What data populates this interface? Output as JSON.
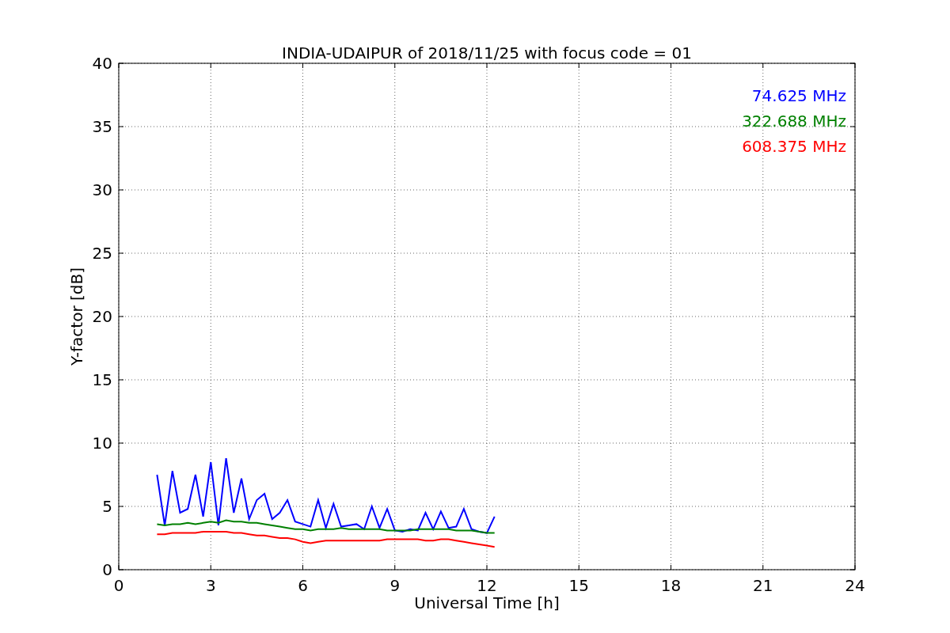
{
  "figure": {
    "chart_data": {
      "type": "line",
      "title": "INDIA-UDAIPUR of 2018/11/25 with focus code = 01",
      "xlabel": "Universal Time [h]",
      "ylabel": "Y-factor [dB]",
      "x": [
        1.25,
        1.5,
        1.75,
        2,
        2.25,
        2.5,
        2.75,
        3,
        3.25,
        3.5,
        3.75,
        4,
        4.25,
        4.5,
        4.75,
        5,
        5.25,
        5.5,
        5.75,
        6,
        6.25,
        6.5,
        6.75,
        7,
        7.25,
        7.5,
        7.75,
        8,
        8.25,
        8.5,
        8.75,
        9,
        9.25,
        9.5,
        9.75,
        10,
        10.25,
        10.5,
        10.75,
        11,
        11.25,
        11.5,
        11.75,
        12,
        12.25
      ],
      "series": [
        {
          "name": "74.625 MHz",
          "color": "#0000ff",
          "values": [
            7.5,
            3.5,
            7.8,
            4.5,
            4.8,
            7.5,
            4.2,
            8.5,
            3.5,
            8.8,
            4.5,
            7.2,
            4.0,
            5.5,
            6.0,
            4.0,
            4.5,
            5.5,
            3.8,
            3.6,
            3.4,
            5.5,
            3.3,
            5.2,
            3.4,
            3.5,
            3.6,
            3.2,
            5.0,
            3.3,
            4.8,
            3.1,
            3.0,
            3.2,
            3.1,
            4.5,
            3.2,
            4.6,
            3.3,
            3.4,
            4.8,
            3.2,
            3.0,
            2.9,
            4.2
          ]
        },
        {
          "name": "322.688 MHz",
          "color": "#008000",
          "values": [
            3.6,
            3.5,
            3.6,
            3.6,
            3.7,
            3.6,
            3.7,
            3.8,
            3.7,
            3.9,
            3.8,
            3.8,
            3.7,
            3.7,
            3.6,
            3.5,
            3.4,
            3.3,
            3.2,
            3.2,
            3.1,
            3.2,
            3.2,
            3.2,
            3.3,
            3.2,
            3.2,
            3.2,
            3.2,
            3.2,
            3.1,
            3.1,
            3.1,
            3.1,
            3.2,
            3.2,
            3.2,
            3.2,
            3.2,
            3.1,
            3.1,
            3.1,
            3.0,
            2.9,
            2.9
          ]
        },
        {
          "name": "608.375 MHz",
          "color": "#ff0000",
          "values": [
            2.8,
            2.8,
            2.9,
            2.9,
            2.9,
            2.9,
            3.0,
            3.0,
            3.0,
            3.0,
            2.9,
            2.9,
            2.8,
            2.7,
            2.7,
            2.6,
            2.5,
            2.5,
            2.4,
            2.2,
            2.1,
            2.2,
            2.3,
            2.3,
            2.3,
            2.3,
            2.3,
            2.3,
            2.3,
            2.3,
            2.4,
            2.4,
            2.4,
            2.4,
            2.4,
            2.3,
            2.3,
            2.4,
            2.4,
            2.3,
            2.2,
            2.1,
            2.0,
            1.9,
            1.8
          ]
        }
      ],
      "grid": true,
      "xlim": [
        0,
        24
      ],
      "ylim": [
        0,
        40
      ],
      "xticks": [
        0,
        3,
        6,
        9,
        12,
        15,
        18,
        21,
        24
      ],
      "yticks": [
        0,
        5,
        10,
        15,
        20,
        25,
        30,
        35,
        40
      ]
    }
  }
}
